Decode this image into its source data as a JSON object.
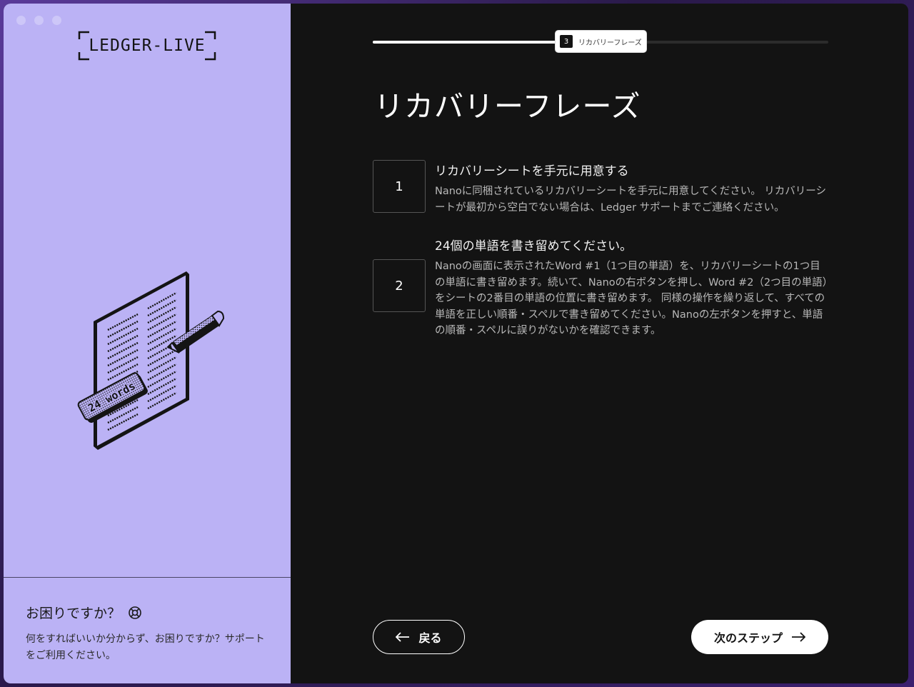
{
  "app": {
    "logo_text": "LEDGER-LIVE"
  },
  "progress": {
    "step_number": "3",
    "step_label": "リカバリーフレーズ",
    "fraction": 0.41
  },
  "page": {
    "title": "リカバリーフレーズ"
  },
  "steps": [
    {
      "number": "1",
      "heading": "リカバリーシートを手元に用意する",
      "description": "Nanoに同梱されているリカバリーシートを手元に用意してください。 リカバリーシートが最初から空白でない場合は、Ledger サポートまでご連絡ください。"
    },
    {
      "number": "2",
      "heading": "24個の単語を書き留めてください。",
      "description": "Nanoの画面に表示されたWord #1（1つ目の単語）を、リカバリーシートの1つ目の単語に書き留めます。続いて、Nanoの右ボタンを押し、Word #2（2つ目の単語）をシートの2番目の単語の位置に書き留めます。 同様の操作を繰り返して、すべての単語を正しい順番・スペルで書き留めてください。Nanoの左ボタンを押すと、単語の順番・スペルに誤りがないかを確認できます。"
    }
  ],
  "illustration": {
    "badge_text": "24 words"
  },
  "help": {
    "title": "お困りですか？",
    "text": "何をすればいいか分からず、お困りですか？サポートをご利用ください。"
  },
  "buttons": {
    "back_label": "戻る",
    "next_label": "次のステップ"
  },
  "colors": {
    "left_panel": "#bbb2f5",
    "main_bg": "#131313",
    "accent_white": "#ffffff"
  }
}
